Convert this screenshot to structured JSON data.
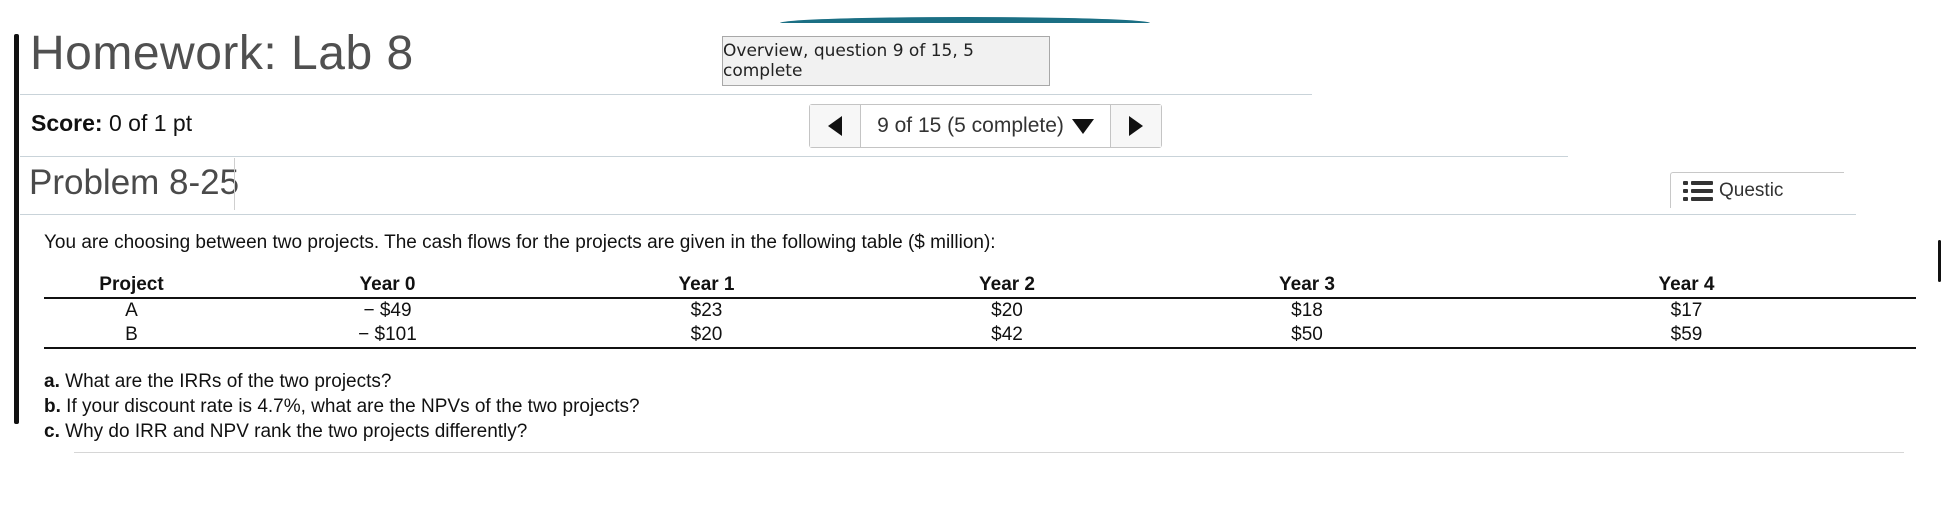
{
  "header": {
    "title": "Homework: Lab 8",
    "overview_label": "Overview, question 9 of 15, 5 complete"
  },
  "score": {
    "label": "Score:",
    "value": "0 of 1 pt"
  },
  "question_nav": {
    "current": "9 of 15 (5 complete)",
    "prev_icon": "triangle-left-icon",
    "next_icon": "triangle-right-icon",
    "dropdown_icon": "triangle-down-icon"
  },
  "problem": {
    "title": "Problem 8-25",
    "questions_button": "Questic",
    "prompt": "You are choosing between two projects. The cash flows for the projects are given in the following table ($ million):"
  },
  "table": {
    "headers": [
      "Project",
      "Year 0",
      "Year 1",
      "Year 2",
      "Year 3",
      "Year 4"
    ],
    "rows": [
      [
        "A",
        "− $49",
        "$23",
        "$20",
        "$18",
        "$17"
      ],
      [
        "B",
        "− $101",
        "$20",
        "$42",
        "$50",
        "$59"
      ]
    ]
  },
  "parts": [
    {
      "letter": "a.",
      "text": "What are the IRRs of the two projects?"
    },
    {
      "letter": "b.",
      "text": "If your discount rate is 4.7%, what are the NPVs of the two projects?"
    },
    {
      "letter": "c.",
      "text": "Why do IRR and NPV rank the two projects differently?"
    }
  ]
}
